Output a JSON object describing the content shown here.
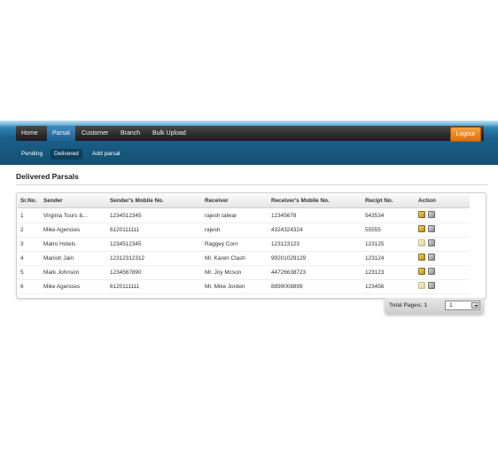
{
  "nav": {
    "items": [
      {
        "label": "Home"
      },
      {
        "label": "Parsal"
      },
      {
        "label": "Customer"
      },
      {
        "label": "Branch"
      },
      {
        "label": "Bulk Upload"
      }
    ],
    "active": "Parsal",
    "logout_label": "Logout",
    "accent_color": "#e87f17"
  },
  "subnav": {
    "items": [
      {
        "label": "Pending"
      },
      {
        "label": "Delivered"
      },
      {
        "label": "Add parsal"
      }
    ],
    "active": "Delivered"
  },
  "page": {
    "title": "Delivered Parsals"
  },
  "table": {
    "columns": [
      "Sr.No.",
      "Sender",
      "Sender's Mobile No.",
      "Receiver",
      "Receiver's Mobile No.",
      "Recipt No.",
      "Action"
    ],
    "rows": [
      {
        "sr": "1",
        "sender": "Virginia Tours &...",
        "sender_mobile": "1234512345",
        "receiver": "rajesh talwar",
        "receiver_mobile": "12345678",
        "receipt": "543534"
      },
      {
        "sr": "2",
        "sender": "Mike Agencies",
        "sender_mobile": "6120111111",
        "receiver": "rajesh",
        "receiver_mobile": "4324324324",
        "receipt": "55555"
      },
      {
        "sr": "3",
        "sender": "Matro Hotels",
        "sender_mobile": "1234512345",
        "receiver": "Raggey Corn",
        "receiver_mobile": "123123123",
        "receipt": "123125"
      },
      {
        "sr": "4",
        "sender": "Manish Jain",
        "sender_mobile": "12312312312",
        "receiver": "Mr. Karen Clash",
        "receiver_mobile": "99201029129",
        "receipt": "123124"
      },
      {
        "sr": "5",
        "sender": "Mark Johnson",
        "sender_mobile": "1234567890",
        "receiver": "Mr. Joy Mcson",
        "receiver_mobile": "44726638723",
        "receipt": "123123"
      },
      {
        "sr": "6",
        "sender": "Mike Agencies",
        "sender_mobile": "6120111111",
        "receiver": "Mr. Mike Jorden",
        "receiver_mobile": "8899008899",
        "receipt": "123456"
      }
    ],
    "action_icons": [
      "edit-icon",
      "delete-icon"
    ]
  },
  "pager": {
    "label": "Total Pages:",
    "total": "1",
    "selected": "1"
  }
}
